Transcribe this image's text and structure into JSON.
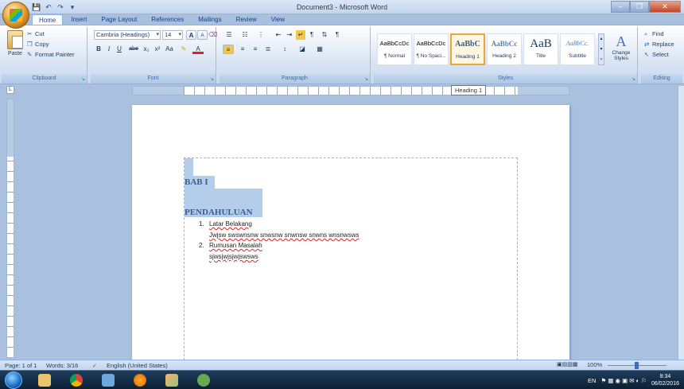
{
  "window": {
    "title": "Document3 - Microsoft Word",
    "controls": [
      "–",
      "❐",
      "✕"
    ]
  },
  "tabs": [
    "Home",
    "Insert",
    "Page Layout",
    "References",
    "Mailings",
    "Review",
    "View"
  ],
  "clipboard": {
    "paste": "Paste",
    "cut": "Cut",
    "copy": "Copy",
    "format_painter": "Format Painter",
    "label": "Clipboard"
  },
  "font": {
    "family": "Cambria (Headings)",
    "size": "14",
    "grow": "A",
    "shrink": "A",
    "bold": "B",
    "italic": "I",
    "underline": "U",
    "strike": "abe",
    "subscript": "x₂",
    "superscript": "x²",
    "change_case": "Aa",
    "font_color": "A",
    "label": "Font"
  },
  "paragraph": {
    "label": "Paragraph"
  },
  "styles": {
    "label": "Styles",
    "items": [
      {
        "sample": "AaBbCcDc",
        "name": "¶ Normal"
      },
      {
        "sample": "AaBbCcDc",
        "name": "¶ No Spaci..."
      },
      {
        "sample": "AaBbC",
        "name": "Heading 1",
        "selected": true
      },
      {
        "sample": "AaBbCc",
        "name": "Heading 2"
      },
      {
        "sample": "AaB",
        "name": "Title"
      },
      {
        "sample": "AaBbCc.",
        "name": "Subtitle"
      }
    ],
    "change_styles": "Change Styles"
  },
  "editing": {
    "label": "Editing",
    "find": "Find",
    "replace": "Replace",
    "select": "Select"
  },
  "ruler": {
    "tooltip": "Heading 1",
    "numbers": [
      "1",
      "2",
      "3",
      "4",
      "5",
      "6",
      "7"
    ]
  },
  "document": {
    "heading1": "BAB I",
    "heading2": "PENDAHULUAN",
    "list": [
      {
        "num": "1.",
        "title": "Latar Belakang",
        "body": "Jwjsw swswnsnw snwsnw snwnsw snwns wnsnwsws"
      },
      {
        "num": "2.",
        "title": "Rumusan Masalah",
        "body": "sjwsjwjsjwjswsws"
      }
    ]
  },
  "status": {
    "page": "Page: 1 of 1",
    "words": "Words: 3/16",
    "language": "English (United States)",
    "zoom": "100%"
  },
  "taskbar": {
    "lang": "EN",
    "time": "8:34",
    "date": "06/02/2016"
  },
  "colors": {
    "heading": "#365f91",
    "selection": "#b4cdeb",
    "ribbon_accent": "#8db2e3"
  }
}
